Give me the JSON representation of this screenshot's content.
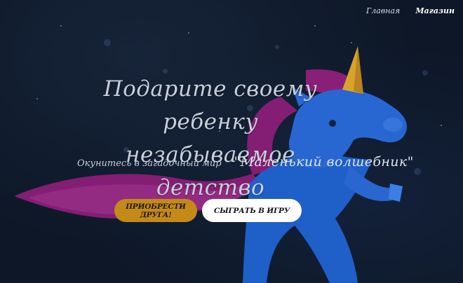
{
  "nav": {
    "items": [
      {
        "label": "Главная",
        "active": false
      },
      {
        "label": "Магазин",
        "active": true
      }
    ]
  },
  "hero": {
    "title_line1": "Подарите своему ребенку",
    "title_line2": "незабываемое детство",
    "subtitle": "Окунитесь в загадочный мир",
    "game_name": "\"Маленький волшебник\""
  },
  "buttons": {
    "buy_friend": "ПРИОБРЕСТИ ДРУГА!",
    "play_game": "СЫГРАТЬ В ИГРУ"
  },
  "colors": {
    "background": "#0d1727",
    "unicorn_body": "#1f5fc8",
    "unicorn_mane": "#8a1f78",
    "horn": "#d9a32a",
    "buy_button": "#c48a17",
    "play_button": "#ffffff"
  },
  "illustration": {
    "icon": "unicorn-illustration"
  }
}
